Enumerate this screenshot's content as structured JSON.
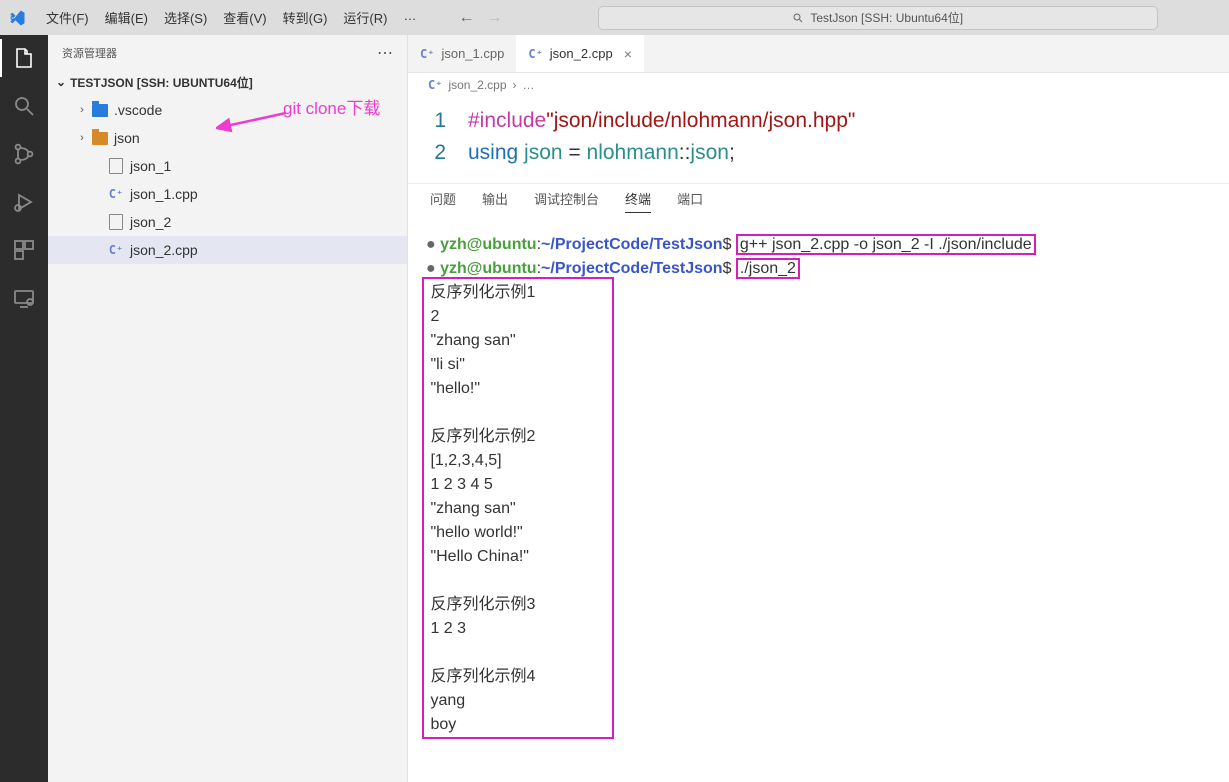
{
  "titlebar": {
    "menu": [
      "文件(F)",
      "编辑(E)",
      "选择(S)",
      "查看(V)",
      "转到(G)",
      "运行(R)",
      "…"
    ],
    "search_label": "TestJson [SSH: Ubuntu64位]"
  },
  "sidebar": {
    "title": "资源管理器",
    "project": "TESTJSON [SSH: UBUNTU64位]",
    "items": [
      {
        "kind": "folder",
        "icon": "vscode",
        "label": ".vscode",
        "expandable": true,
        "indent": 1
      },
      {
        "kind": "folder",
        "icon": "json",
        "label": "json",
        "expandable": true,
        "indent": 1
      },
      {
        "kind": "file",
        "icon": "generic",
        "label": "json_1",
        "indent": 2
      },
      {
        "kind": "file",
        "icon": "cpp",
        "label": "json_1.cpp",
        "indent": 2
      },
      {
        "kind": "file",
        "icon": "generic",
        "label": "json_2",
        "indent": 2
      },
      {
        "kind": "file",
        "icon": "cpp",
        "label": "json_2.cpp",
        "indent": 2,
        "selected": true
      }
    ],
    "annotation": "git clone下载"
  },
  "tabs": [
    {
      "label": "json_1.cpp",
      "active": false
    },
    {
      "label": "json_2.cpp",
      "active": true
    }
  ],
  "breadcrumb": {
    "file": "json_2.cpp",
    "more": "…"
  },
  "code": {
    "lines": [
      {
        "n": "1",
        "segments": [
          {
            "t": "#include",
            "c": "kw-pink"
          },
          {
            "t": "\"json/include/nlohmann/json.hpp\"",
            "c": "str-red"
          }
        ]
      },
      {
        "n": "2",
        "segments": [
          {
            "t": "using ",
            "c": "id-blue"
          },
          {
            "t": "json",
            "c": "fn-teal"
          },
          {
            "t": " = ",
            "c": ""
          },
          {
            "t": "nlohmann",
            "c": "fn-teal"
          },
          {
            "t": "::",
            "c": ""
          },
          {
            "t": "json",
            "c": "fn-teal"
          },
          {
            "t": ";",
            "c": ""
          }
        ]
      }
    ]
  },
  "panel_tabs": [
    "问题",
    "输出",
    "调试控制台",
    "终端",
    "端口"
  ],
  "panel_active": "终端",
  "terminal": {
    "prompt_user": "yzh@ubuntu",
    "prompt_path": "~/ProjectCode/TestJson",
    "cmds": [
      "g++ json_2.cpp -o json_2 -I ./json/include",
      "./json_2"
    ],
    "output": [
      "反序列化示例1",
      "2",
      "\"zhang san\"",
      "\"li si\"",
      "\"hello!\"",
      "",
      "反序列化示例2",
      "[1,2,3,4,5]",
      "1 2 3 4 5",
      "\"zhang san\"",
      "\"hello world!\"",
      "\"Hello China!\"",
      "",
      "反序列化示例3",
      "1 2 3",
      "",
      "反序列化示例4",
      "yang",
      "boy"
    ]
  }
}
